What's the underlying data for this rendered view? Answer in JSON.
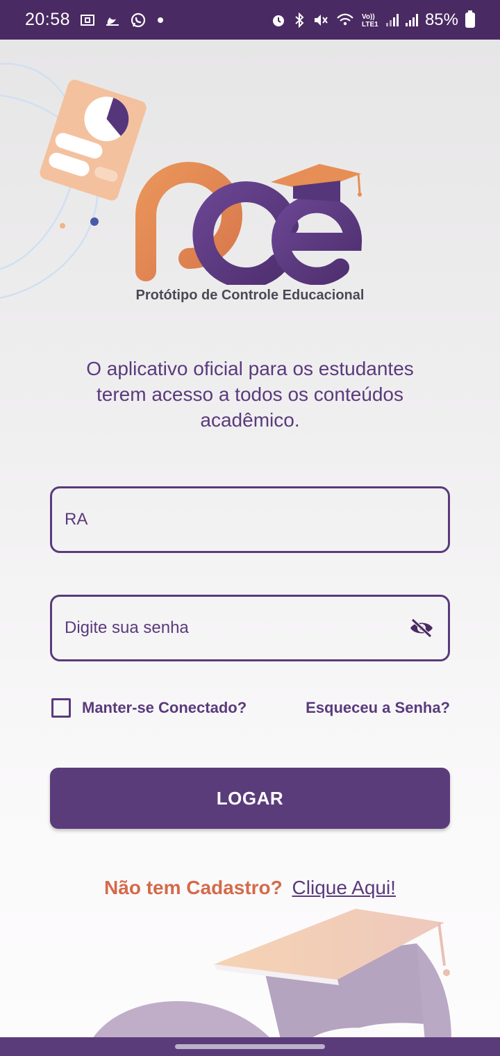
{
  "status_bar": {
    "time": "20:58",
    "battery_percent": "85%",
    "left_icons": [
      "screenshot-icon",
      "moon-icon",
      "whatsapp-icon",
      "dot-icon"
    ],
    "right_icons": [
      "alarm-icon",
      "bluetooth-icon",
      "mute-icon",
      "wifi-icon",
      "volte-icon",
      "signal-icon",
      "signal-icon",
      "battery-icon"
    ],
    "volte_label": "Vo))\nLTE1"
  },
  "logo": {
    "mark_text": "pce",
    "subtitle": "Protótipo de Controle Educacional"
  },
  "tagline": "O aplicativo oficial para os estudantes terem acesso a todos os conteúdos acadêmico.",
  "form": {
    "ra_placeholder": "RA",
    "password_placeholder": "Digite sua senha",
    "keep_connected_label": "Manter-se Conectado?",
    "forgot_password_label": "Esqueceu a Senha?",
    "login_button_label": "LOGAR"
  },
  "signup": {
    "question": "Não tem Cadastro?",
    "link": "Clique Aqui!"
  },
  "colors": {
    "primary": "#5b3c7b",
    "status_bar": "#4a2a63",
    "accent_orange": "#d46a4a",
    "logo_orange": "#e48a55"
  }
}
